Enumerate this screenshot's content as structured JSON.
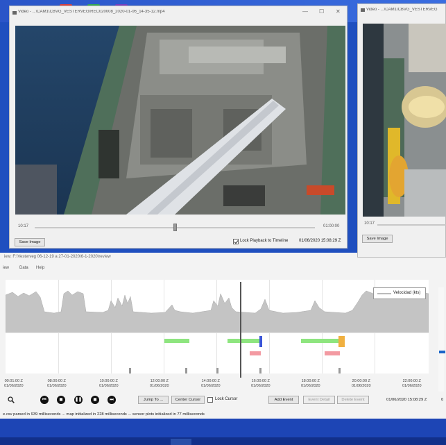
{
  "video_main": {
    "title": "Video - ...\\CAM1\\CBVG_VESTERVEG\\REC020008_2020-01-06_14-35-12.mp4",
    "time_start": "10:17",
    "time_end": "01:00:00",
    "save_label": "Save Image",
    "lock_label": "Lock Playback to Timeline",
    "timestamp": "01/06/2020 15:08:29 Z",
    "progress": 0.5
  },
  "video_second": {
    "title": "Video - ...\\CAM1\\CBVG_VESTERVEG",
    "time_start": "10:17",
    "save_label": "Save Image"
  },
  "app": {
    "title": "iew: F:\\Vesterveg 06-12-19 a 27-01-2020\\6-1-2020\\review",
    "menu": [
      "iew",
      "Data",
      "Help"
    ]
  },
  "legend": {
    "label": "Velocidad (kts)"
  },
  "ticks": [
    {
      "time": "00:01:00 Z",
      "date": "01/06/2020"
    },
    {
      "time": "08:00:00 Z",
      "date": "01/06/2020"
    },
    {
      "time": "10:00:00 Z",
      "date": "01/06/2020"
    },
    {
      "time": "12:00:00 Z",
      "date": "01/06/2020"
    },
    {
      "time": "14:00:00 Z",
      "date": "01/06/2020"
    },
    {
      "time": "16:00:00 Z",
      "date": "01/06/2020"
    },
    {
      "time": "18:00:00 Z",
      "date": "01/06/2020"
    },
    {
      "time": "20:00:00 Z",
      "date": "01/06/2020"
    },
    {
      "time": "22:00:00 Z",
      "date": "01/06/2020"
    }
  ],
  "controls": {
    "jump_to": "Jump To ...",
    "center_cursor": "Center Cursor",
    "lock_cursor": "Lock Cursor",
    "add_event": "Add Event",
    "event_detail": "Event Detail",
    "delete_event": "Delete Event",
    "timestamp": "01/06/2020 15:08:29 Z",
    "timestamp_cut": "0"
  },
  "status": "e.csv parsed in 939 milliseconds ... map initialized in 228 milliseconds ... sensor plots initialized in 77 milliseconds",
  "colors": {
    "green": "#8ee57f",
    "pink": "#f39aa2",
    "blue": "#3a55d8",
    "orange": "#f0b040",
    "gray_bar": "#999999"
  }
}
